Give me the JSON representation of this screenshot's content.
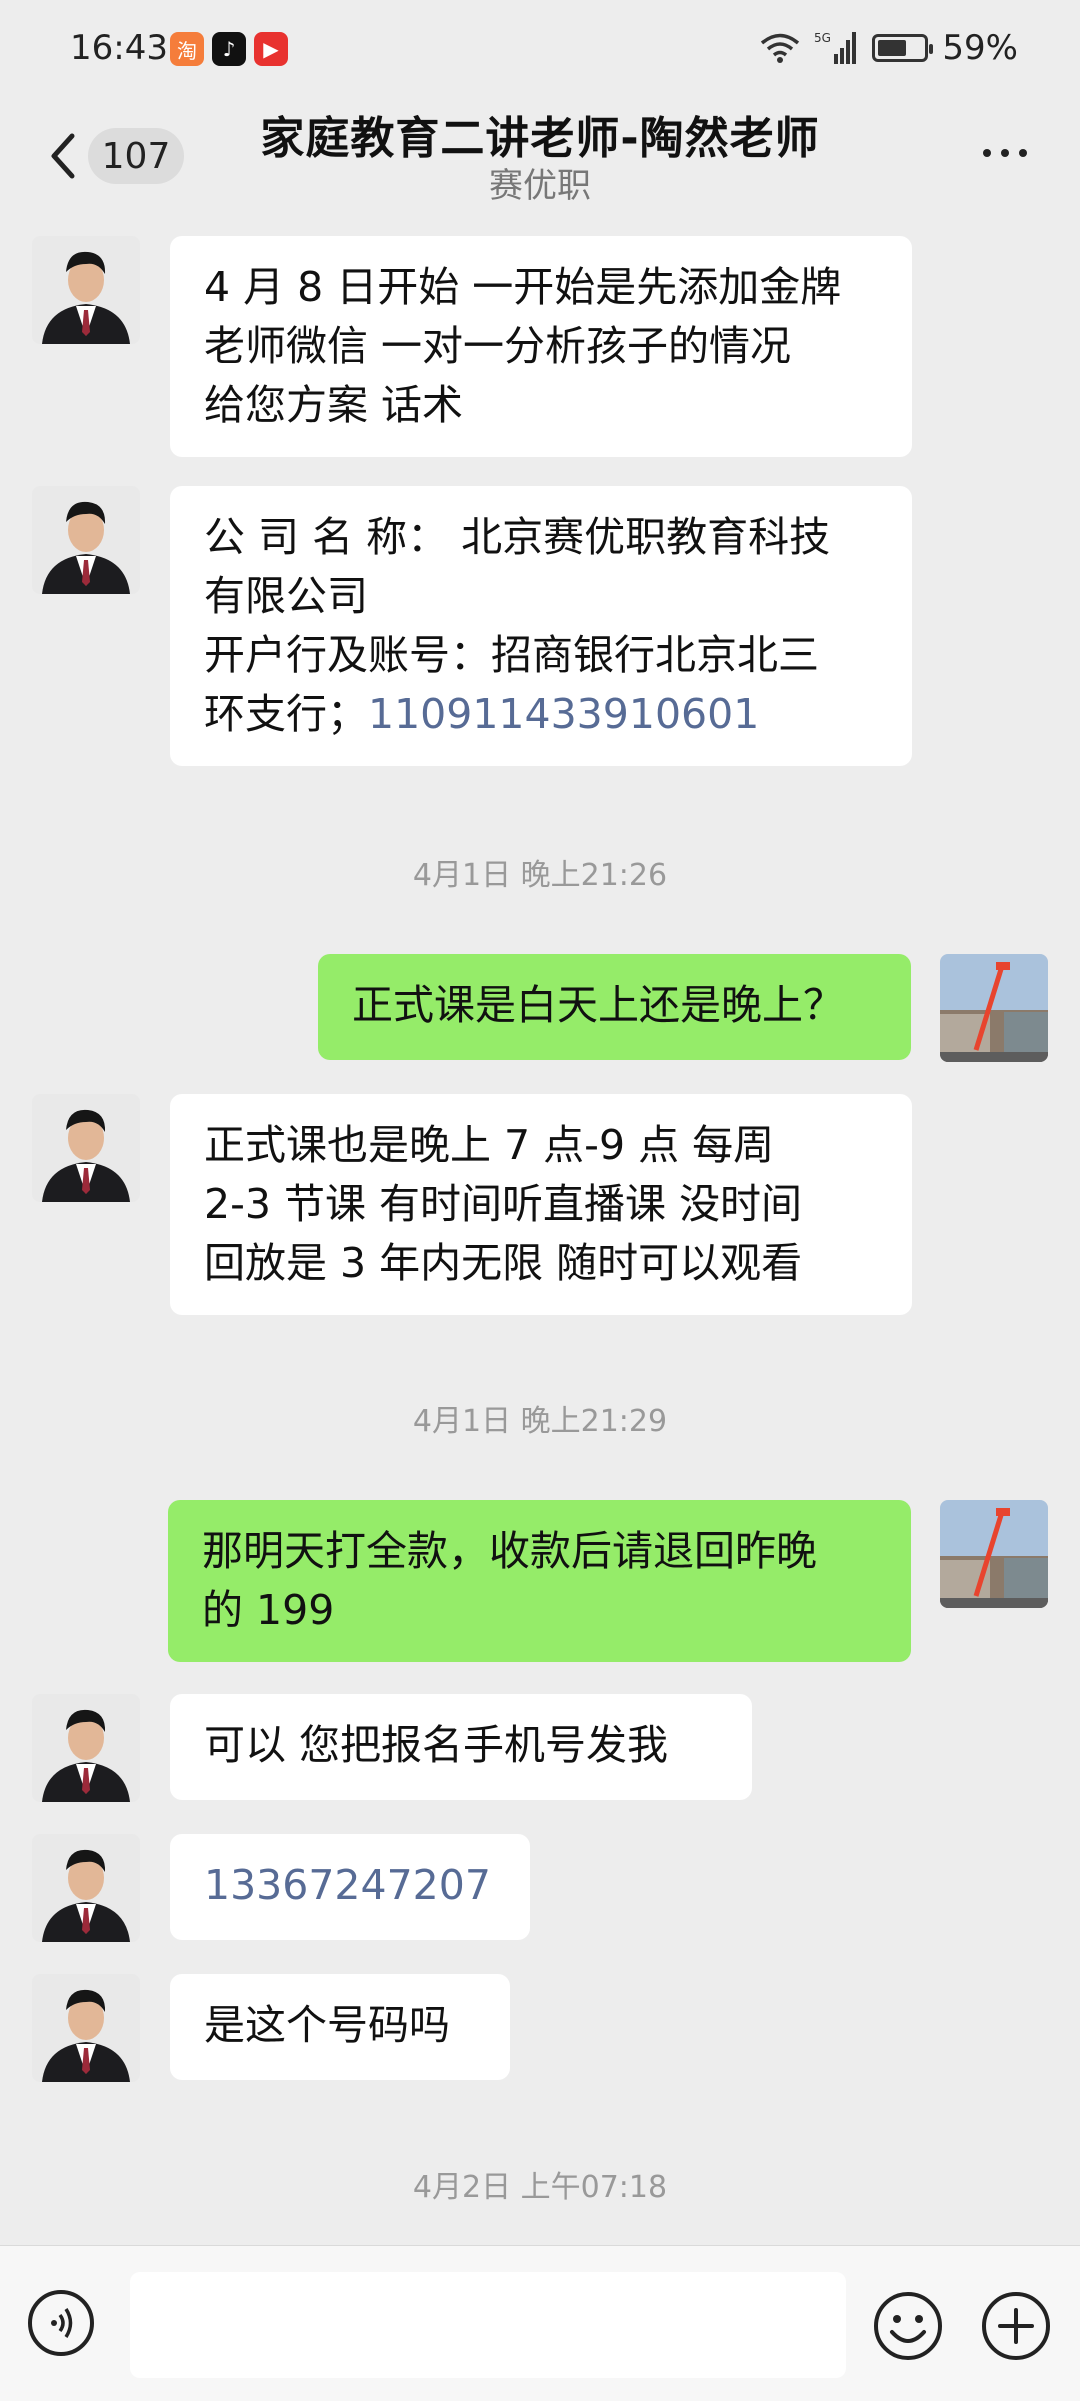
{
  "status_bar": {
    "time": "16:43",
    "battery_percent": "59%",
    "network": "5G",
    "app_icons": [
      "taobao-icon",
      "douyin-icon",
      "kuaishou-icon"
    ]
  },
  "header": {
    "unread_count": "107",
    "title": "家庭教育二讲老师-陶然老师",
    "subtitle": "赛优职"
  },
  "messages": [
    {
      "side": "in",
      "lines": [
        "4 月 8 日开始 一开始是先添加金牌",
        "老师微信 一对一分析孩子的情况",
        "给您方案 话术"
      ]
    },
    {
      "side": "in",
      "lines": [
        "公 司 名 称：  北京赛优职教育科技",
        "有限公司",
        "开户行及账号：招商银行北京北三",
        "环支行；"
      ],
      "link": "110911433910601"
    },
    {
      "timestamp": "4月1日 晚上21:26"
    },
    {
      "side": "out",
      "lines": [
        "正式课是白天上还是晚上？"
      ]
    },
    {
      "side": "in",
      "lines": [
        "正式课也是晚上 7 点-9 点 每周",
        "2-3 节课 有时间听直播课 没时间",
        "回放是 3 年内无限  随时可以观看"
      ]
    },
    {
      "timestamp": "4月1日 晚上21:29"
    },
    {
      "side": "out",
      "lines": [
        "那明天打全款，收款后请退回昨晚",
        "的 199"
      ]
    },
    {
      "side": "in",
      "lines": [
        "可以 您把报名手机号发我"
      ]
    },
    {
      "side": "in",
      "link": "13367247207"
    },
    {
      "side": "in",
      "lines": [
        "是这个号码吗"
      ]
    },
    {
      "timestamp": "4月2日 上午07:18"
    }
  ],
  "colors": {
    "background": "#ededed",
    "incoming_bubble": "#ffffff",
    "outgoing_bubble": "#95ec69",
    "link": "#576b95"
  }
}
